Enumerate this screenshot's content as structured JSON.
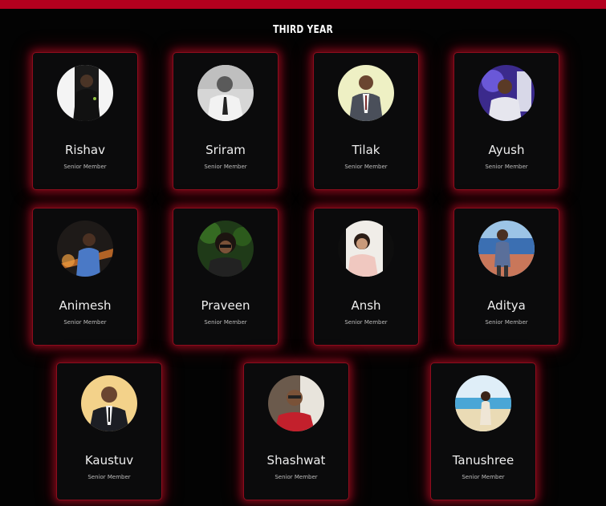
{
  "section": {
    "title": "THIRD YEAR"
  },
  "members": [
    {
      "name": "Rishav",
      "role": "Senior Member"
    },
    {
      "name": "Sriram",
      "role": "Senior Member"
    },
    {
      "name": "Tilak",
      "role": "Senior Member"
    },
    {
      "name": "Ayush",
      "role": "Senior Member"
    },
    {
      "name": "Animesh",
      "role": "Senior Member"
    },
    {
      "name": "Praveen",
      "role": "Senior Member"
    },
    {
      "name": "Ansh",
      "role": "Senior Member"
    },
    {
      "name": "Aditya",
      "role": "Senior Member"
    },
    {
      "name": "Kaustuv",
      "role": "Senior Member"
    },
    {
      "name": "Shashwat",
      "role": "Senior Member"
    },
    {
      "name": "Tanushree",
      "role": "Senior Member"
    }
  ],
  "colors": {
    "accent": "#b3001e",
    "card_glow": "#c80c26",
    "background": "#030303"
  }
}
